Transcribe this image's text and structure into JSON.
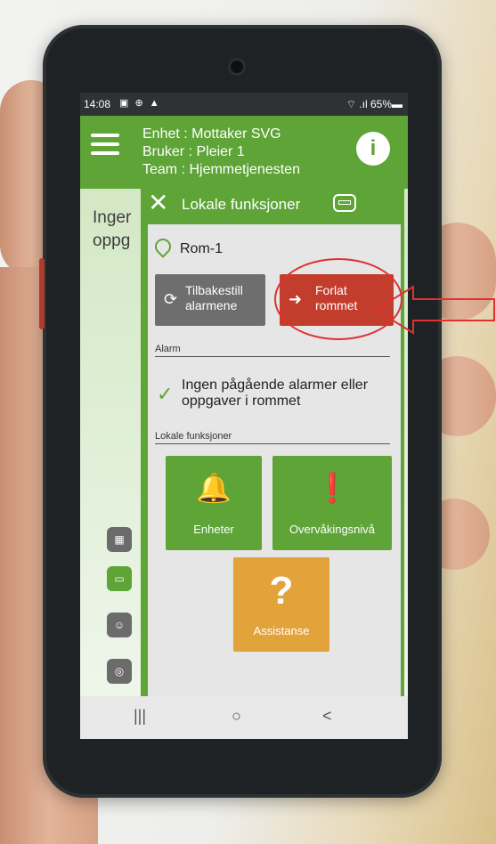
{
  "status_bar": {
    "time": "14:08",
    "indicators": "▣ ⊕ ▲",
    "battery": "⌔ .ıl 65%▬"
  },
  "header": {
    "unit": "Enhet : Mottaker SVG",
    "user": "Bruker : Pleier 1",
    "team": "Team : Hjemmetjenesten"
  },
  "background": {
    "text_line1": "Inger",
    "text_line2": "oppg"
  },
  "panel": {
    "title": "Lokale funksjoner",
    "room": "Rom-1",
    "reset_label_1": "Tilbakestill",
    "reset_label_2": "alarmene",
    "leave_label_1": "Forlat",
    "leave_label_2": "rommet",
    "alarm_section": "Alarm",
    "no_alarm_line1": "Ingen pågående alarmer eller",
    "no_alarm_line2": "oppgaver i rommet",
    "local_section": "Lokale funksjoner",
    "tiles": {
      "units": "Enheter",
      "monitoring": "Overvåkingsnivå",
      "assist": "Assistanse"
    }
  },
  "icons": {
    "menu": "menu-icon",
    "logo": "app-logo-icon",
    "close": "close-icon",
    "bed": "bed-icon",
    "pin": "location-pin-icon",
    "reset": "refresh-icon",
    "leave": "exit-door-icon",
    "check": "check-icon",
    "units": "bell-gear-icon",
    "monitoring": "bell-exclamation-icon",
    "assist": "question-mark-icon"
  },
  "colors": {
    "brand_green": "#5ea437",
    "alert_red": "#c33d2c",
    "assist_orange": "#e3a33b",
    "annotation_red": "#e03030"
  }
}
